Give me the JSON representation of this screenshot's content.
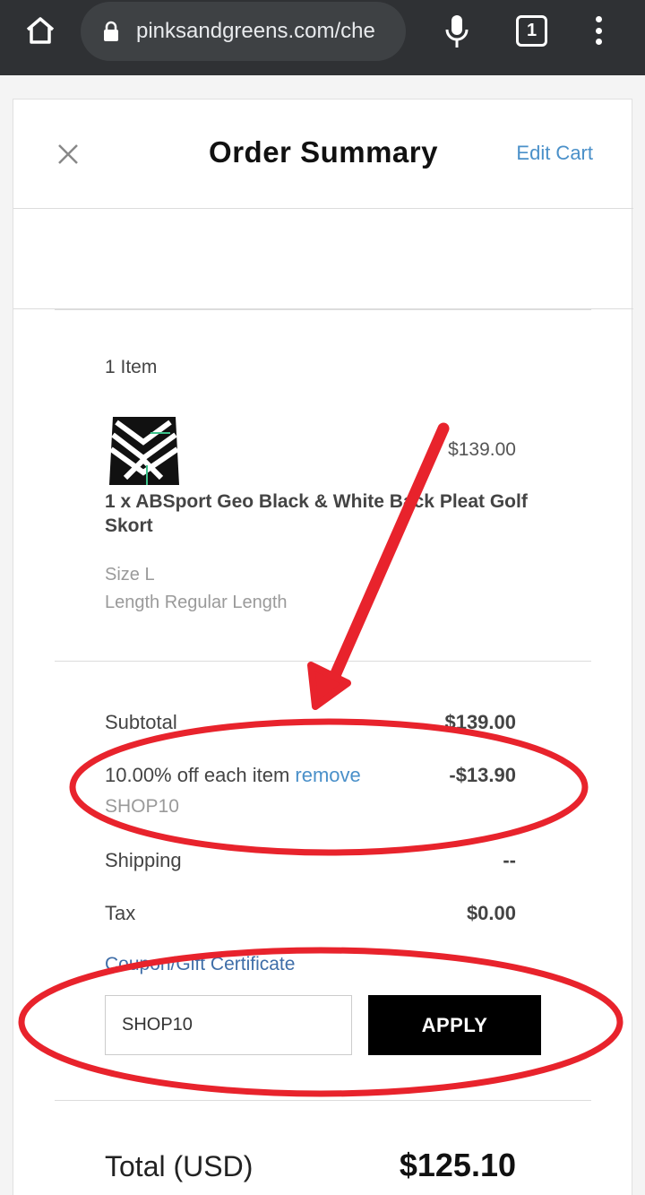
{
  "browser": {
    "url": "pinksandgreens.com/che",
    "tab_count": "1"
  },
  "header": {
    "title": "Order Summary",
    "edit_cart": "Edit Cart"
  },
  "cart": {
    "item_count": "1 Item",
    "item": {
      "name": "1 x ABSport Geo Black & White Back Pleat Golf Skort",
      "price": "$139.00",
      "size": "Size L",
      "length": "Length Regular Length"
    }
  },
  "totals": {
    "subtotal_label": "Subtotal",
    "subtotal_value": "$139.00",
    "discount_label": "10.00% off each item",
    "discount_remove": "remove",
    "discount_value": "-$13.90",
    "discount_code": "SHOP10",
    "shipping_label": "Shipping",
    "shipping_value": "--",
    "tax_label": "Tax",
    "tax_value": "$0.00",
    "coupon_link": "Coupon/Gift Certificate",
    "coupon_input_value": "SHOP10",
    "apply_label": "APPLY",
    "total_label": "Total (USD)",
    "total_value": "$125.10"
  },
  "colors": {
    "link": "#4a90c9",
    "annotation": "#e8232c",
    "chrome": "#2f3134"
  }
}
